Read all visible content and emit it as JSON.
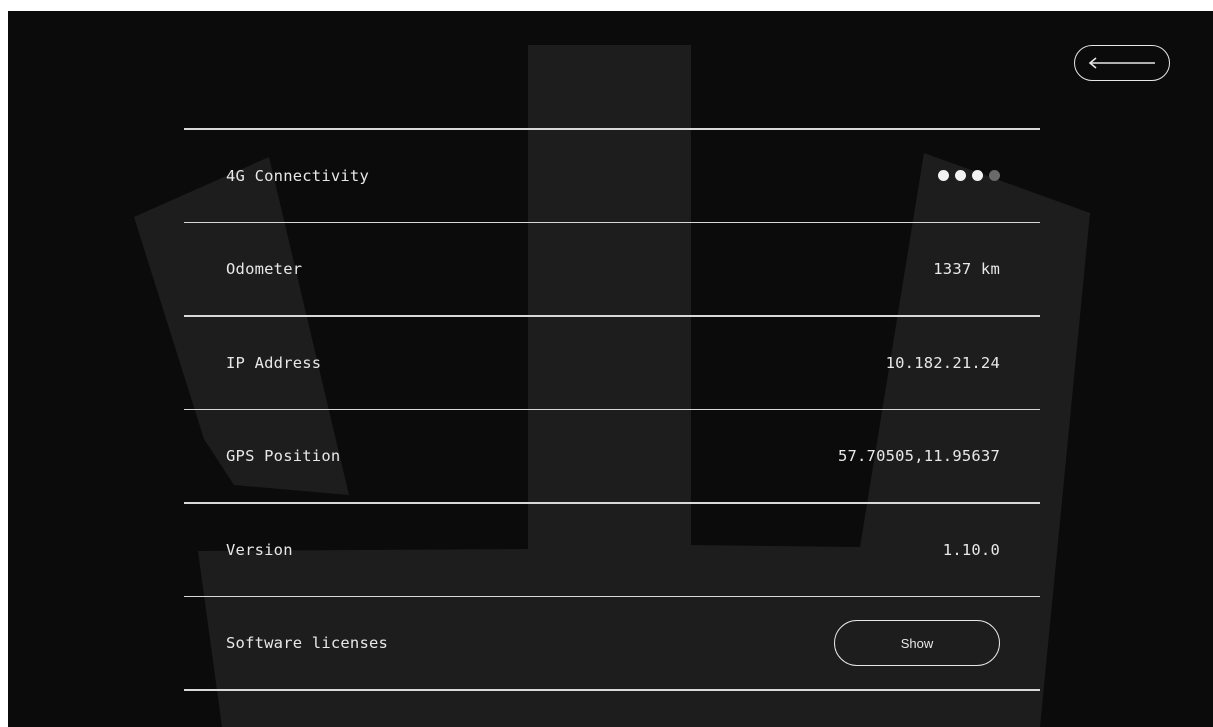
{
  "back_button": {
    "icon": "arrow-left-icon"
  },
  "rows": [
    {
      "label": "4G Connectivity",
      "signal_level": 3,
      "signal_max": 4
    },
    {
      "label": "Odometer",
      "value": "1337 km"
    },
    {
      "label": "IP Address",
      "value": "10.182.21.24"
    },
    {
      "label": "GPS Position",
      "value": "57.70505,11.95637"
    },
    {
      "label": "Version",
      "value": "1.10.0"
    },
    {
      "label": "Software licenses",
      "button_label": "Show"
    }
  ],
  "colors": {
    "background": "#0b0b0b",
    "backdrop_shape": "#1d1d1d",
    "foreground": "#e8e8e8",
    "divider": "#d9d9d9",
    "signal_on": "#f2f2f2",
    "signal_off": "#6a6a6a"
  }
}
